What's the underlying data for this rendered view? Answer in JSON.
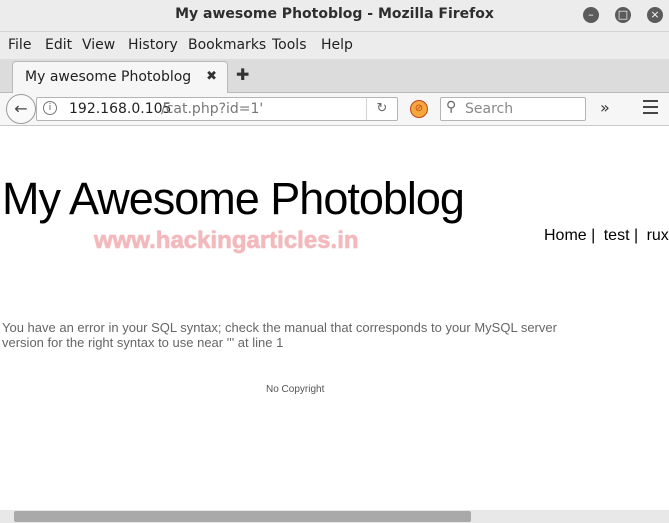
{
  "window": {
    "title": "My awesome Photoblog - Mozilla Firefox"
  },
  "menubar": [
    "File",
    "Edit",
    "View",
    "History",
    "Bookmarks",
    "Tools",
    "Help"
  ],
  "tab": {
    "label": "My awesome Photoblog",
    "close": "✖"
  },
  "navbar": {
    "url_host": "192.168.0.105",
    "url_path": "/cat.php?id=1'",
    "search_placeholder": "Search"
  },
  "page": {
    "site_title": "My Awesome Photoblog",
    "watermark": "www.hackingarticles.in",
    "nav": [
      "Home |",
      "test |",
      "ruxcon"
    ],
    "error_text": "You have an error in your SQL syntax; check the manual that corresponds to your MySQL server version for the right syntax to use near ''' at line 1",
    "footer": "No Copyright"
  }
}
